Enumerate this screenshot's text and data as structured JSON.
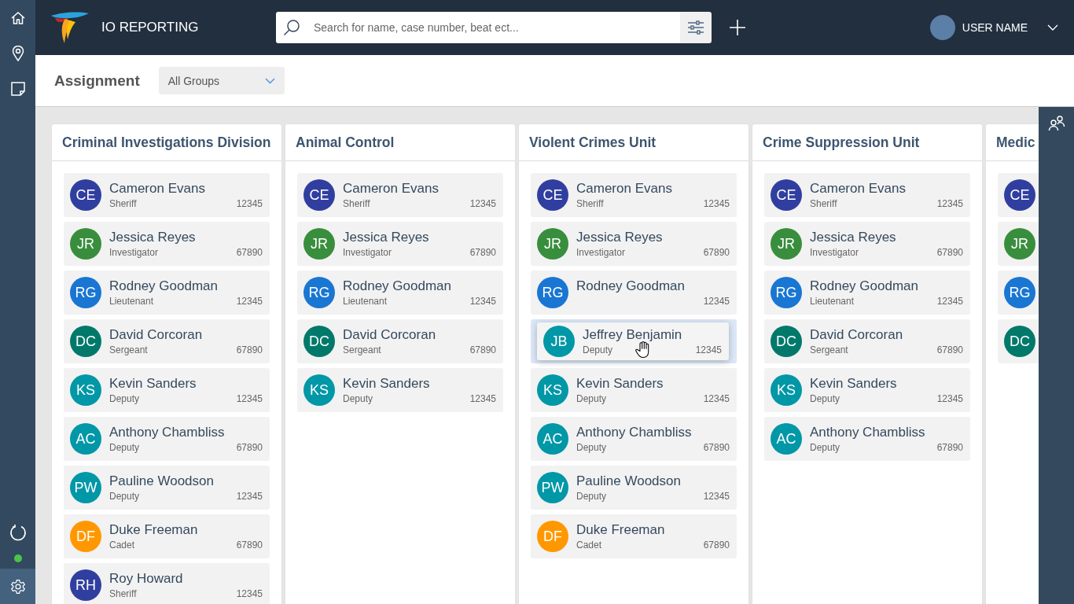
{
  "app": {
    "title": "IO REPORTING"
  },
  "sidebar": {
    "items": [
      {
        "kind": "home",
        "selected": false
      },
      {
        "kind": "location",
        "selected": false
      },
      {
        "kind": "notes",
        "selected": false
      }
    ],
    "bottom_items": [
      {
        "kind": "refresh",
        "selected": false
      },
      {
        "kind": "settings",
        "selected": true
      }
    ]
  },
  "search": {
    "placeholder": "Search for name, case number, beat ect..."
  },
  "user": {
    "name": "USER NAME"
  },
  "page": {
    "title": "Assignment",
    "group_filter": "All Groups"
  },
  "columns": [
    {
      "title": "Criminal Investigations Division",
      "members": [
        {
          "kind": "member",
          "initials": "CE",
          "name": "Cameron Evans",
          "rank": "Sheriff",
          "number": "12345",
          "color": "#303f9f"
        },
        {
          "kind": "member",
          "initials": "JR",
          "name": "Jessica Reyes",
          "rank": "Investigator",
          "number": "67890",
          "color": "#388e3c"
        },
        {
          "kind": "member",
          "initials": "RG",
          "name": "Rodney Goodman",
          "rank": "Lieutenant",
          "number": "12345",
          "color": "#1976d2"
        },
        {
          "kind": "member",
          "initials": "DC",
          "name": "David Corcoran",
          "rank": "Sergeant",
          "number": "67890",
          "color": "#00796b"
        },
        {
          "kind": "member",
          "initials": "KS",
          "name": "Kevin Sanders",
          "rank": "Deputy",
          "number": "12345",
          "color": "#0097a7"
        },
        {
          "kind": "member",
          "initials": "AC",
          "name": "Anthony Chambliss",
          "rank": "Deputy",
          "number": "67890",
          "color": "#0097a7"
        },
        {
          "kind": "member",
          "initials": "PW",
          "name": "Pauline Woodson",
          "rank": "Deputy",
          "number": "12345",
          "color": "#0097a7"
        },
        {
          "kind": "member",
          "initials": "DF",
          "name": "Duke Freeman",
          "rank": "Cadet",
          "number": "67890",
          "color": "#ff9800"
        },
        {
          "kind": "member",
          "initials": "RH",
          "name": "Roy Howard",
          "rank": "Sheriff",
          "number": "12345",
          "color": "#303f9f"
        }
      ]
    },
    {
      "title": "Animal Control",
      "members": [
        {
          "kind": "member",
          "initials": "CE",
          "name": "Cameron Evans",
          "rank": "Sheriff",
          "number": "12345",
          "color": "#303f9f"
        },
        {
          "kind": "member",
          "initials": "JR",
          "name": "Jessica Reyes",
          "rank": "Investigator",
          "number": "67890",
          "color": "#388e3c"
        },
        {
          "kind": "member",
          "initials": "RG",
          "name": "Rodney Goodman",
          "rank": "Lieutenant",
          "number": "12345",
          "color": "#1976d2"
        },
        {
          "kind": "member",
          "initials": "DC",
          "name": "David Corcoran",
          "rank": "Sergeant",
          "number": "67890",
          "color": "#00796b"
        },
        {
          "kind": "member",
          "initials": "KS",
          "name": "Kevin Sanders",
          "rank": "Deputy",
          "number": "12345",
          "color": "#0097a7"
        }
      ]
    },
    {
      "title": "Violent Crimes Unit",
      "members": [
        {
          "kind": "member",
          "initials": "CE",
          "name": "Cameron Evans",
          "rank": "Sheriff",
          "number": "12345",
          "color": "#303f9f"
        },
        {
          "kind": "member",
          "initials": "JR",
          "name": "Jessica Reyes",
          "rank": "Investigator",
          "number": "67890",
          "color": "#388e3c"
        },
        {
          "kind": "member",
          "initials": "RG",
          "name": "Rodney Goodman",
          "number": "12345",
          "color": "#1976d2"
        },
        {
          "kind": "drop-target"
        },
        {
          "kind": "member",
          "initials": "KS",
          "name": "Kevin Sanders",
          "rank": "Deputy",
          "number": "12345",
          "color": "#0097a7"
        },
        {
          "kind": "member",
          "initials": "AC",
          "name": "Anthony Chambliss",
          "rank": "Deputy",
          "number": "67890",
          "color": "#0097a7"
        },
        {
          "kind": "member",
          "initials": "PW",
          "name": "Pauline Woodson",
          "rank": "Deputy",
          "number": "12345",
          "color": "#0097a7"
        },
        {
          "kind": "member",
          "initials": "DF",
          "name": "Duke Freeman",
          "rank": "Cadet",
          "number": "67890",
          "color": "#ff9800"
        }
      ]
    },
    {
      "title": "Crime Suppression Unit",
      "members": [
        {
          "kind": "member",
          "initials": "CE",
          "name": "Cameron Evans",
          "rank": "Sheriff",
          "number": "12345",
          "color": "#303f9f"
        },
        {
          "kind": "member",
          "initials": "JR",
          "name": "Jessica Reyes",
          "rank": "Investigator",
          "number": "67890",
          "color": "#388e3c"
        },
        {
          "kind": "member",
          "initials": "RG",
          "name": "Rodney Goodman",
          "rank": "Lieutenant",
          "number": "12345",
          "color": "#1976d2"
        },
        {
          "kind": "member",
          "initials": "DC",
          "name": "David Corcoran",
          "rank": "Sergeant",
          "number": "67890",
          "color": "#00796b"
        },
        {
          "kind": "member",
          "initials": "KS",
          "name": "Kevin Sanders",
          "rank": "Deputy",
          "number": "12345",
          "color": "#0097a7"
        },
        {
          "kind": "member",
          "initials": "AC",
          "name": "Anthony Chambliss",
          "rank": "Deputy",
          "number": "67890",
          "color": "#0097a7"
        }
      ]
    },
    {
      "title": "Medic",
      "members": [
        {
          "kind": "member",
          "initials": "CE",
          "color": "#303f9f"
        },
        {
          "kind": "member",
          "initials": "JR",
          "color": "#388e3c"
        },
        {
          "kind": "member",
          "initials": "RG",
          "color": "#1976d2"
        },
        {
          "kind": "member",
          "initials": "DC",
          "color": "#00796b"
        }
      ]
    }
  ],
  "dragged_card": {
    "initials": "JB",
    "name": "Jeffrey Benjamin",
    "rank": "Deputy",
    "number": "12345",
    "color": "#0097a7"
  }
}
